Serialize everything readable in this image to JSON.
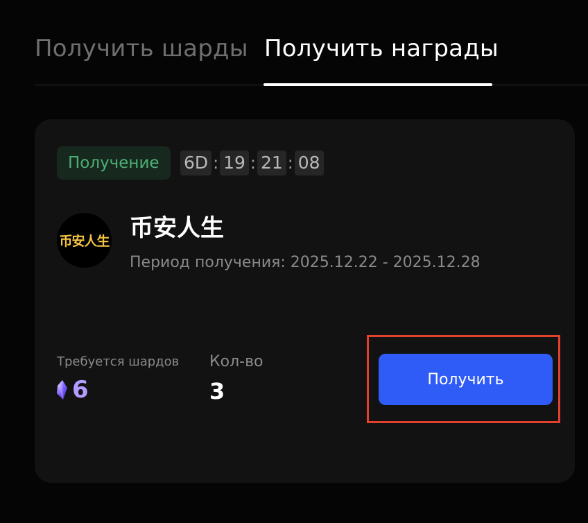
{
  "tabs": [
    {
      "label": "Получить шарды",
      "active": false
    },
    {
      "label": "Получить награды",
      "active": true
    }
  ],
  "card": {
    "status": "Получение",
    "timer": {
      "days": "6D",
      "hours": "19",
      "minutes": "21",
      "seconds": "08",
      "separator": ":"
    },
    "avatar_text": "币安人生",
    "title": "币安人生",
    "period": "Период получения: 2025.12.22 - 2025.12.28",
    "required_label": "Требуется шардов",
    "required_value": "6",
    "quantity_label": "Кол-во",
    "quantity_value": "3",
    "claim_label": "Получить"
  },
  "colors": {
    "accent": "#2f5bf6",
    "status_text": "#4caf74",
    "status_bg": "#17291f",
    "shard": "#b39cff",
    "highlight": "#e2422d"
  },
  "icons": {
    "shard": "crystal-shard-icon"
  }
}
